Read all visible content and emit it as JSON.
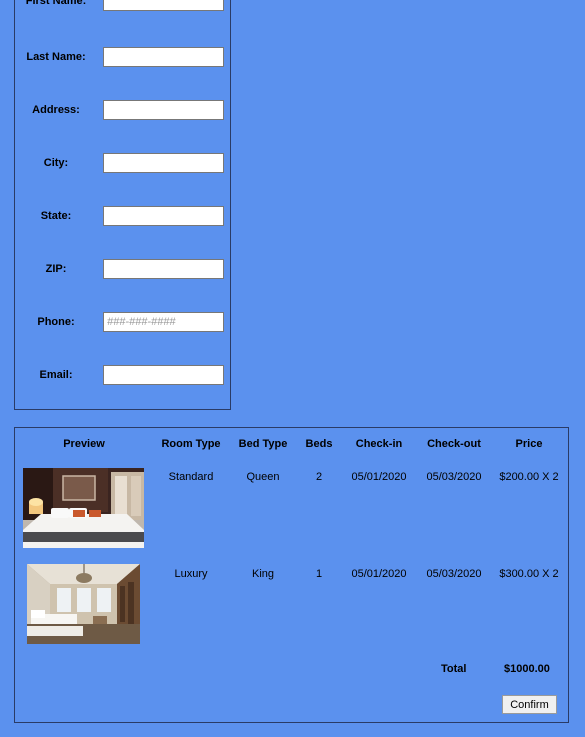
{
  "form": {
    "fields": [
      {
        "label": "First Name:",
        "value": "",
        "placeholder": ""
      },
      {
        "label": "Last Name:",
        "value": "",
        "placeholder": ""
      },
      {
        "label": "Address:",
        "value": "",
        "placeholder": ""
      },
      {
        "label": "City:",
        "value": "",
        "placeholder": ""
      },
      {
        "label": "State:",
        "value": "",
        "placeholder": ""
      },
      {
        "label": "ZIP:",
        "value": "",
        "placeholder": ""
      },
      {
        "label": "Phone:",
        "value": "",
        "placeholder": "###-###-####"
      },
      {
        "label": "Email:",
        "value": "",
        "placeholder": ""
      }
    ]
  },
  "table": {
    "headers": [
      "Preview",
      "Room Type",
      "Bed Type",
      "Beds",
      "Check-in",
      "Check-out",
      "Price"
    ],
    "rows": [
      {
        "room_type": "Standard",
        "bed_type": "Queen",
        "beds": "2",
        "check_in": "05/01/2020",
        "check_out": "05/03/2020",
        "price": "$200.00 X 2"
      },
      {
        "room_type": "Luxury",
        "bed_type": "King",
        "beds": "1",
        "check_in": "05/01/2020",
        "check_out": "05/03/2020",
        "price": "$300.00 X 2"
      }
    ],
    "total_label": "Total",
    "total_value": "$1000.00",
    "confirm_label": "Confirm"
  }
}
